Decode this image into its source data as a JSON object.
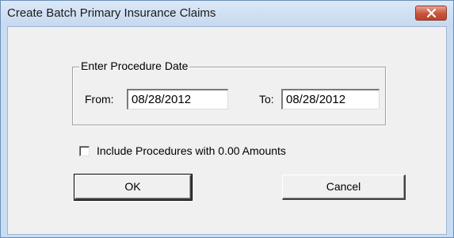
{
  "window": {
    "title": "Create Batch Primary Insurance Claims",
    "close_icon": "close-x-icon"
  },
  "procedure_date": {
    "group_label": "Enter Procedure Date",
    "from_label": "From:",
    "from_value": "08/28/2012",
    "to_label": "To:",
    "to_value": "08/28/2012"
  },
  "options": {
    "include_zero_label": "Include Procedures with 0.00 Amounts",
    "include_zero_checked": false
  },
  "buttons": {
    "ok_label": "OK",
    "cancel_label": "Cancel"
  },
  "colors": {
    "close_button": "#c9533b",
    "title_bar": "#c8dcf2",
    "client_area": "#f0f0f0"
  }
}
